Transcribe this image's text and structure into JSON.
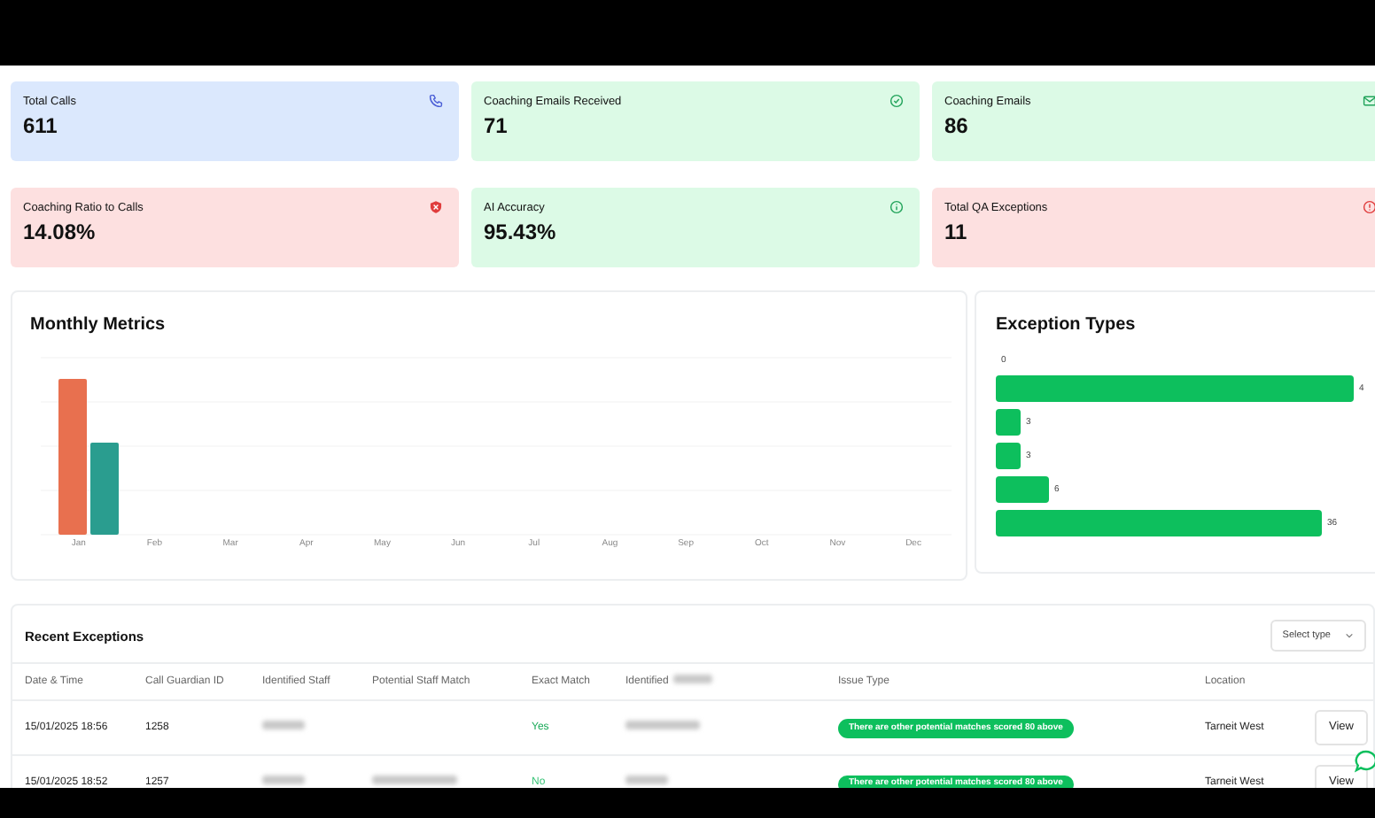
{
  "stats": [
    {
      "label": "Total Calls",
      "value": "611",
      "color": "#dbe8fd"
    },
    {
      "label": "Coaching Emails Received",
      "value": "71",
      "color": "#dcfae6"
    },
    {
      "label": "Coaching Emails",
      "value": "86",
      "color": "#dcfae6"
    },
    {
      "label": "Coaching Ratio to Calls",
      "value": "14.08%",
      "color": "#fde0e0"
    },
    {
      "label": "AI Accuracy",
      "value": "95.43%",
      "color": "#dcfae6"
    },
    {
      "label": "Total QA Exceptions",
      "value": "11",
      "color": "#fde0e0"
    }
  ],
  "monthly_metrics": {
    "title": "Monthly Metrics",
    "months": [
      "Jan",
      "Feb",
      "Mar",
      "Apr",
      "May",
      "Jun",
      "Jul",
      "Aug",
      "Sep",
      "Oct",
      "Nov",
      "Dec"
    ]
  },
  "exception_types": {
    "title": "Exception Types",
    "bars": [
      {
        "label": "0"
      },
      {
        "label": "4"
      },
      {
        "label": "3"
      },
      {
        "label": "3"
      },
      {
        "label": "6"
      },
      {
        "label": "36"
      }
    ]
  },
  "recent_exceptions": {
    "title": "Recent Exceptions",
    "filter": {
      "placeholder": "Select type"
    },
    "columns": [
      "Date & Time",
      "Call Guardian ID",
      "Identified Staff",
      "Potential Staff Match",
      "Exact Match",
      "Identified",
      "Issue Type",
      "Location"
    ],
    "rows": [
      {
        "date": "15/01/2025 18:56",
        "id": "1258",
        "staff_redacted": true,
        "exact": "Yes",
        "exact_match": true,
        "issues": [
          "There are other potential matches scored 80 above"
        ],
        "location": "Tarneit West",
        "action": "View"
      },
      {
        "date": "15/01/2025 18:52",
        "id": "1257",
        "staff_redacted": true,
        "potential_redacted": true,
        "exact": "No",
        "exact_match": false,
        "issues": [
          "There are other potential matches scored 80 above"
        ],
        "location": "Tarneit West",
        "action": "View"
      }
    ]
  }
}
